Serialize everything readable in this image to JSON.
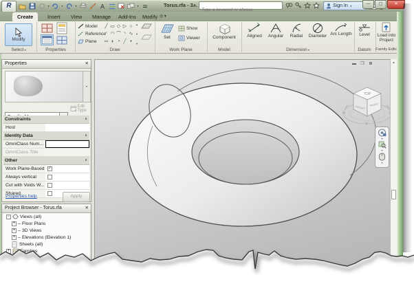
{
  "window": {
    "title": "Torus.rfa - 3..."
  },
  "titlebar": {
    "search_placeholder": "Type a keyword or phrase",
    "sign_in": "Sign In"
  },
  "tabs": {
    "items": [
      "Create",
      "Insert",
      "View",
      "Manage",
      "Add-Ins",
      "Modify"
    ],
    "active": "Create"
  },
  "ribbon": {
    "select": {
      "panel": "Select",
      "modify": "Modify"
    },
    "properties": {
      "panel": "Properties"
    },
    "draw": {
      "panel": "Draw",
      "model": "Model",
      "reference": "Reference",
      "plane": "Plane"
    },
    "workplane": {
      "panel": "Work Plane",
      "set": "Set",
      "show": "Show",
      "viewer": "Viewer"
    },
    "model": {
      "panel": "Model",
      "component": "Component"
    },
    "dimension": {
      "panel": "Dimension",
      "aligned": "Aligned",
      "angular": "Angular",
      "radial": "Radial",
      "diameter": "Diameter",
      "arc_length": "Arc Length"
    },
    "datum": {
      "panel": "Datum",
      "level": "Level"
    },
    "family_editor": {
      "panel": "Family Editor",
      "load": "Load into Project"
    }
  },
  "properties_palette": {
    "title": "Properties",
    "family": "Family: Mass",
    "edit_type": "Edit Type",
    "constraints": {
      "header": "Constraints",
      "host": "Host",
      "host_value": ""
    },
    "identity": {
      "header": "Identity Data",
      "omniclass_number": "OmniClass Num...",
      "omniclass_number_value": "",
      "omniclass_title": "OmniClass Title",
      "omniclass_title_value": ""
    },
    "other": {
      "header": "Other",
      "rows": [
        {
          "label": "Work Plane-Based",
          "checked": true
        },
        {
          "label": "Always vertical",
          "checked": false
        },
        {
          "label": "Cut with Voids W...",
          "checked": false
        },
        {
          "label": "Shared",
          "checked": false
        }
      ]
    },
    "help": "Properties help",
    "apply": "Apply"
  },
  "project_browser": {
    "title": "Project Browser - Torus.rfa",
    "views_all": "Views (all)",
    "floor_plans": "Floor Plans",
    "three_d_views": "3D Views",
    "elevations": "Elevations (Elevation 1)",
    "sheets": "Sheets (all)",
    "families": "Families"
  },
  "viewcube": {
    "top": "TOP",
    "front": "FRONT",
    "right": "RIGHT"
  },
  "colors": {
    "titlebar_green": "#aab4a0",
    "window_border_green": "#accfa0",
    "selection_blue": "#bcd6ee",
    "canvas_grey": "#c8c8c8"
  }
}
